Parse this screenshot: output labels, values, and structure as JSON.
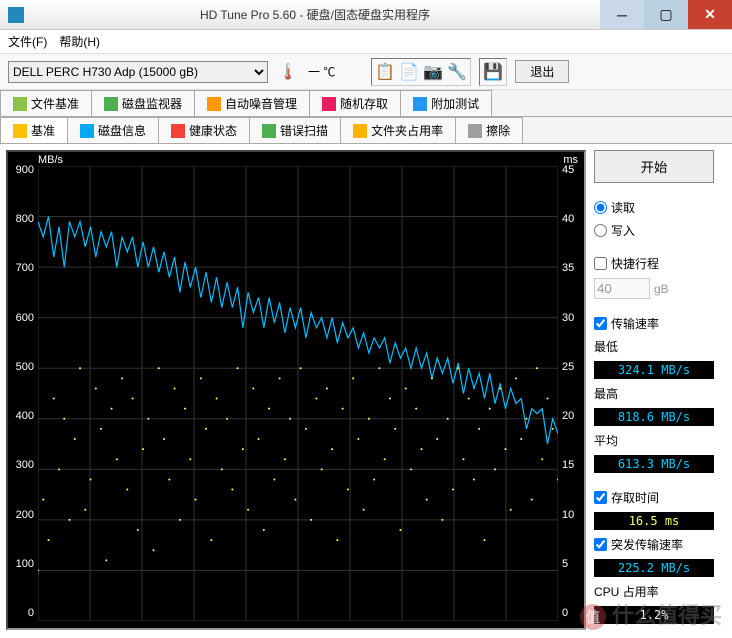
{
  "window": {
    "title": "HD Tune Pro 5.60 - 硬盘/固态硬盘实用程序"
  },
  "menu": {
    "file": "文件(F)",
    "help": "帮助(H)"
  },
  "toolbar": {
    "drive": "DELL   PERC H730 Adp (15000 gB)",
    "temp_unit": "℃",
    "exit": "退出"
  },
  "tabs_top": [
    {
      "label": "文件基准",
      "ico": "#8bc34a"
    },
    {
      "label": "磁盘监视器",
      "ico": "#4caf50"
    },
    {
      "label": "自动噪音管理",
      "ico": "#ff9800"
    },
    {
      "label": "随机存取",
      "ico": "#e91e63"
    },
    {
      "label": "附加测试",
      "ico": "#2196f3"
    }
  ],
  "tabs_main": [
    {
      "label": "基准",
      "ico": "#ffc107",
      "active": true
    },
    {
      "label": "磁盘信息",
      "ico": "#03a9f4"
    },
    {
      "label": "健康状态",
      "ico": "#f44336"
    },
    {
      "label": "错误扫描",
      "ico": "#4caf50"
    },
    {
      "label": "文件夹占用率",
      "ico": "#ffb300"
    },
    {
      "label": "擦除",
      "ico": "#9e9e9e"
    }
  ],
  "chart_labels": {
    "left_unit": "MB/s",
    "right_unit": "ms"
  },
  "chart_data": {
    "type": "line",
    "xrange": [
      0,
      100
    ],
    "y_left": {
      "min": 0,
      "max": 900,
      "ticks": [
        900,
        800,
        700,
        600,
        500,
        400,
        300,
        200,
        100,
        0
      ]
    },
    "y_right": {
      "min": 0,
      "max": 45,
      "ticks": [
        45,
        40,
        35,
        30,
        25,
        20,
        15,
        10,
        5,
        0
      ]
    },
    "series": [
      {
        "name": "transfer_rate_MBps",
        "axis": "left",
        "color": "#00bfff",
        "values": [
          790,
          760,
          800,
          720,
          780,
          700,
          790,
          760,
          790,
          740,
          780,
          720,
          770,
          740,
          770,
          700,
          760,
          730,
          760,
          700,
          750,
          700,
          740,
          690,
          730,
          680,
          720,
          650,
          710,
          660,
          700,
          640,
          690,
          630,
          680,
          620,
          670,
          620,
          660,
          580,
          650,
          610,
          640,
          580,
          640,
          590,
          630,
          570,
          620,
          580,
          620,
          560,
          610,
          580,
          600,
          560,
          600,
          550,
          590,
          560,
          580,
          540,
          570,
          530,
          560,
          540,
          560,
          510,
          550,
          520,
          540,
          500,
          540,
          500,
          530,
          480,
          520,
          490,
          520,
          470,
          510,
          450,
          500,
          460,
          490,
          440,
          490,
          430,
          470,
          420,
          460,
          430,
          440,
          380,
          420,
          410,
          420,
          350,
          400,
          370
        ]
      }
    ],
    "scatter": {
      "name": "access_time_ms",
      "axis": "right",
      "color": "#ffff66",
      "values": [
        5,
        12,
        8,
        22,
        15,
        20,
        10,
        18,
        25,
        11,
        14,
        23,
        19,
        6,
        21,
        16,
        24,
        13,
        22,
        9,
        17,
        20,
        7,
        25,
        18,
        14,
        23,
        10,
        21,
        16,
        12,
        24,
        19,
        8,
        22,
        15,
        20,
        13,
        25,
        17,
        11,
        23,
        18,
        9,
        21,
        14,
        24,
        16,
        20,
        12,
        25,
        19,
        10,
        22,
        15,
        23,
        17,
        8,
        21,
        13,
        24,
        18,
        11,
        20,
        14,
        25,
        16,
        22,
        19,
        9,
        23,
        15,
        21,
        17,
        12,
        24,
        18,
        10,
        20,
        13,
        25,
        16,
        22,
        14,
        19,
        8,
        21,
        15,
        23,
        17,
        11,
        24,
        18,
        20,
        12,
        25,
        16,
        22,
        19,
        14
      ]
    }
  },
  "side": {
    "start": "开始",
    "read": "读取",
    "write": "写入",
    "short_stroke": "快捷行程",
    "stroke_val": "40",
    "stroke_unit": "gB",
    "transfer_rate": "传输速率",
    "min_label": "最低",
    "min_val": "324.1 MB/s",
    "max_label": "最高",
    "max_val": "818.6 MB/s",
    "avg_label": "平均",
    "avg_val": "613.3 MB/s",
    "access_label": "存取时间",
    "access_val": "16.5 ms",
    "burst_label": "突发传输速率",
    "burst_val": "225.2 MB/s",
    "cpu_label": "CPU 占用率",
    "cpu_val": "1.2%"
  },
  "watermark": "什么值得买"
}
